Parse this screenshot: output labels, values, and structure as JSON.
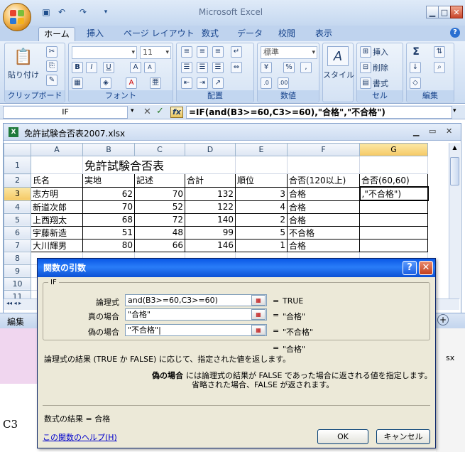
{
  "app": {
    "title": "Microsoft Excel"
  },
  "tabs": [
    "ホーム",
    "挿入",
    "ページ レイアウト",
    "数式",
    "データ",
    "校閲",
    "表示"
  ],
  "ribbon": {
    "groups": {
      "clipboard": "クリップボード",
      "font": "フォント",
      "align": "配置",
      "number": "数値",
      "cells": "セル",
      "edit": "編集"
    },
    "paste_label": "貼り付け",
    "font_size": "11",
    "number_format": "標準",
    "style_label": "スタイル",
    "insert": "挿入",
    "delete": "削除",
    "format": "書式",
    "sigma": "Σ",
    "percent": "%",
    "comma": ","
  },
  "formula_bar": {
    "name_box": "IF",
    "formula": "=IF(and(B3>=60,C3>=60),\"合格\",\"不合格\")",
    "fx": "fx"
  },
  "workbook": {
    "title": "免許試験合否表2007.xlsx"
  },
  "sheet": {
    "columns": [
      "A",
      "B",
      "C",
      "D",
      "E",
      "F",
      "G"
    ],
    "rows": [
      "1",
      "2",
      "3",
      "4",
      "5",
      "6",
      "7",
      "8",
      "9",
      "10",
      "11"
    ],
    "title": "免許試験合否表",
    "headers": [
      "氏名",
      "実地",
      "記述",
      "合計",
      "順位",
      "合否(120以上)",
      "合否(60,60)"
    ],
    "data": [
      [
        "志方明",
        "62",
        "70",
        "132",
        "3",
        "合格",
        ",\"不合格\")"
      ],
      [
        "新道次郎",
        "70",
        "52",
        "122",
        "4",
        "合格",
        ""
      ],
      [
        "上西翔太",
        "68",
        "72",
        "140",
        "2",
        "合格",
        ""
      ],
      [
        "宇藤新造",
        "51",
        "48",
        "99",
        "5",
        "不合格",
        ""
      ],
      [
        "大川輝男",
        "80",
        "66",
        "146",
        "1",
        "合格",
        ""
      ]
    ]
  },
  "status": {
    "mode": "編集"
  },
  "dialog": {
    "title": "関数の引数",
    "func": "IF",
    "args": [
      {
        "label": "論理式",
        "value": "and(B3>=60,C3>=60)",
        "result": "TRUE"
      },
      {
        "label": "真の場合",
        "value": "\"合格\"",
        "result": "\"合格\""
      },
      {
        "label": "偽の場合",
        "value": "\"不合格\"|",
        "result": "\"不合格\""
      }
    ],
    "eq": "=",
    "overall_result": "\"合格\"",
    "description": "論理式の結果 (TRUE か FALSE) に応じて、指定された値を返します。",
    "arg_help_label": "偽の場合",
    "arg_help_line1": "には論理式の結果が FALSE であった場合に返される値を指定します。",
    "arg_help_line2": "省略された場合、FALSE が返されます。",
    "formula_result": "数式の結果 =  合格",
    "help_link": "この関数のヘルプ(H)",
    "ok": "OK",
    "cancel": "キャンセル"
  },
  "background": {
    "left_text": "C3",
    "right_text": "sx"
  }
}
